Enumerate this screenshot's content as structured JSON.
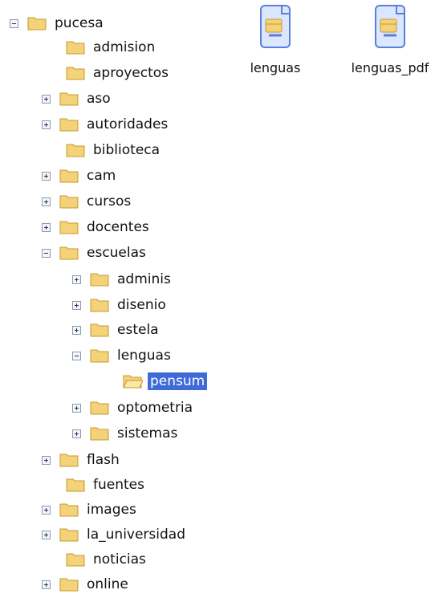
{
  "tree": [
    {
      "id": "pucesa",
      "label": "pucesa",
      "level": 0,
      "toggle": "minus"
    },
    {
      "id": "admision",
      "label": "admision",
      "level": 1,
      "toggle": "none"
    },
    {
      "id": "aproyectos",
      "label": "aproyectos",
      "level": 1,
      "toggle": "none"
    },
    {
      "id": "aso",
      "label": "aso",
      "level": 1,
      "toggle": "plus"
    },
    {
      "id": "autoridades",
      "label": "autoridades",
      "level": 1,
      "toggle": "plus"
    },
    {
      "id": "biblioteca",
      "label": "biblioteca",
      "level": 1,
      "toggle": "none"
    },
    {
      "id": "cam",
      "label": "cam",
      "level": 1,
      "toggle": "plus"
    },
    {
      "id": "cursos",
      "label": "cursos",
      "level": 1,
      "toggle": "plus"
    },
    {
      "id": "docentes",
      "label": "docentes",
      "level": 1,
      "toggle": "plus"
    },
    {
      "id": "escuelas",
      "label": "escuelas",
      "level": 1,
      "toggle": "minus"
    },
    {
      "id": "adminis",
      "label": "adminis",
      "level": 2,
      "toggle": "plus"
    },
    {
      "id": "disenio",
      "label": "disenio",
      "level": 2,
      "toggle": "plus"
    },
    {
      "id": "estela",
      "label": "estela",
      "level": 2,
      "toggle": "plus"
    },
    {
      "id": "lenguas",
      "label": "lenguas",
      "level": 2,
      "toggle": "minus"
    },
    {
      "id": "pensum",
      "label": "pensum",
      "level": 3,
      "toggle": "none",
      "selected": true
    },
    {
      "id": "optometria",
      "label": "optometria",
      "level": 2,
      "toggle": "plus"
    },
    {
      "id": "sistemas",
      "label": "sistemas",
      "level": 2,
      "toggle": "plus"
    },
    {
      "id": "flash",
      "label": "flash",
      "level": 1,
      "toggle": "plus"
    },
    {
      "id": "fuentes",
      "label": "fuentes",
      "level": 1,
      "toggle": "none"
    },
    {
      "id": "images",
      "label": "images",
      "level": 1,
      "toggle": "plus"
    },
    {
      "id": "la_universidad",
      "label": "la_universidad",
      "level": 1,
      "toggle": "plus"
    },
    {
      "id": "noticias",
      "label": "noticias",
      "level": 1,
      "toggle": "none"
    },
    {
      "id": "online",
      "label": "online",
      "level": 1,
      "toggle": "plus"
    }
  ],
  "files": [
    {
      "label": "lenguas",
      "icon": "document-icon"
    },
    {
      "label": "lenguas_pdf",
      "icon": "document-icon"
    }
  ],
  "colors": {
    "folder_fill": "#f3d27a",
    "folder_edge": "#c79a2b",
    "selection": "#3f6bd8",
    "document_blue": "#5b7fd6"
  }
}
